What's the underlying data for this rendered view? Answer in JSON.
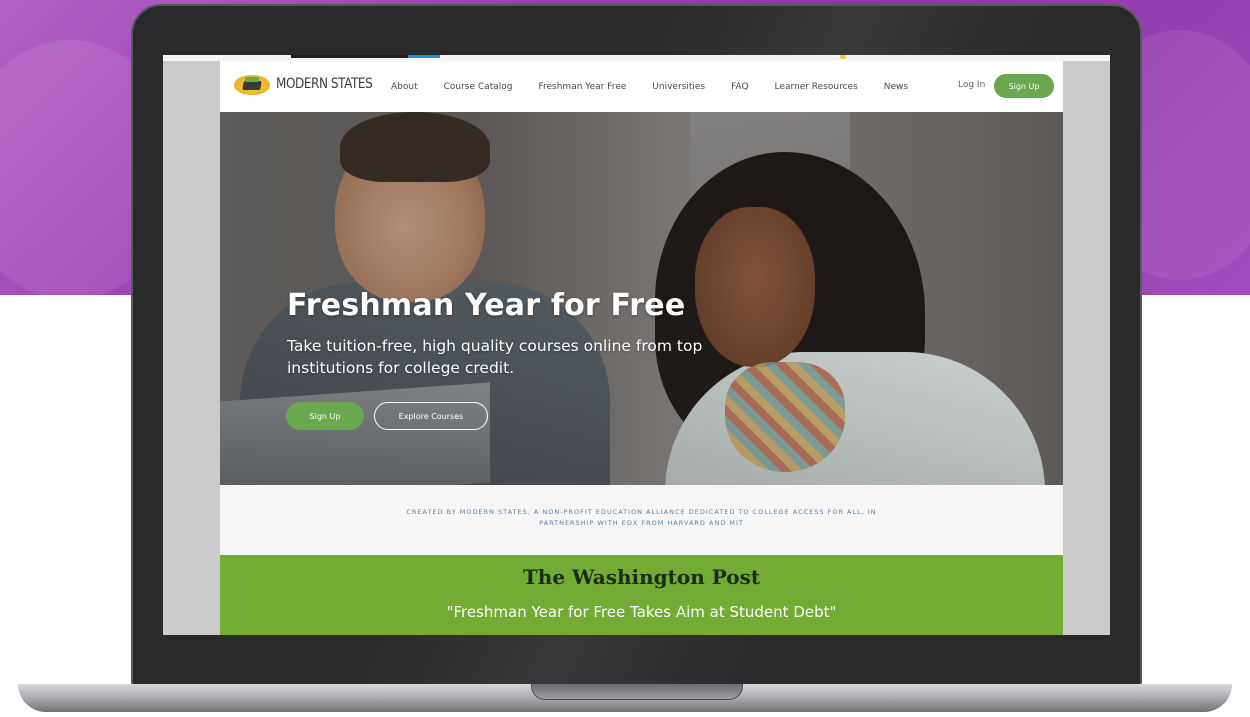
{
  "site": {
    "logo_text": "MODERN STATES",
    "nav": [
      "About",
      "Course Catalog",
      "Freshman Year Free",
      "Universities",
      "FAQ",
      "Learner Resources",
      "News"
    ],
    "login_label": "Log In",
    "signup_label": "Sign Up"
  },
  "hero": {
    "title": "Freshman Year for Free",
    "subtitle": "Take tuition-free, high quality courses online from top institutions for college credit.",
    "signup_label": "Sign Up",
    "explore_label": "Explore Courses"
  },
  "tagline": "CREATED BY MODERN STATES, A NON-PROFIT EDUCATION ALLIANCE DEDICATED TO COLLEGE ACCESS FOR ALL, IN PARTNERSHIP WITH EDX FROM HARVARD AND MIT",
  "press": {
    "outlet": "The Washington Post",
    "quote": "\"Freshman Year for Free Takes Aim at Student Debt\""
  },
  "colors": {
    "brand_green": "#6aa84f",
    "press_green": "#72ac34",
    "background_purple": "#9a3fb2"
  }
}
